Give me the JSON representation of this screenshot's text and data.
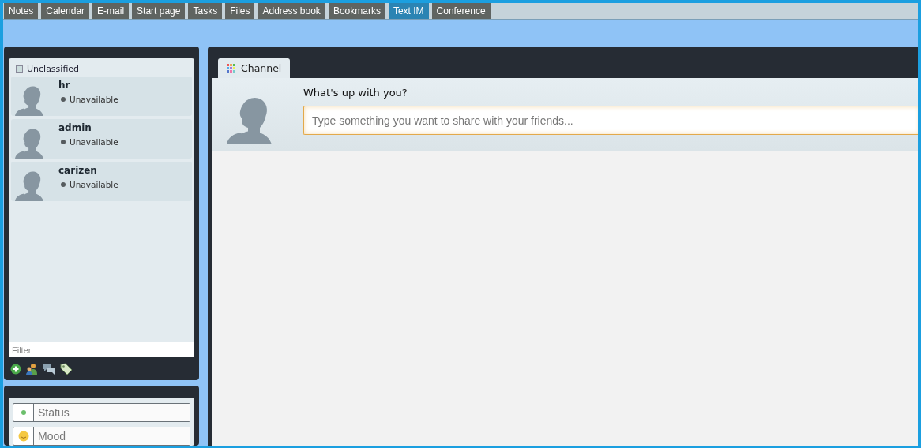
{
  "tabs": [
    {
      "label": "Notes",
      "selected": false
    },
    {
      "label": "Calendar",
      "selected": false
    },
    {
      "label": "E-mail",
      "selected": false
    },
    {
      "label": "Start page",
      "selected": false
    },
    {
      "label": "Tasks",
      "selected": false
    },
    {
      "label": "Files",
      "selected": false
    },
    {
      "label": "Address book",
      "selected": false
    },
    {
      "label": "Bookmarks",
      "selected": false
    },
    {
      "label": "Text IM",
      "selected": true
    },
    {
      "label": "Conference",
      "selected": false
    }
  ],
  "contacts": {
    "group": {
      "label": "Unclassified",
      "expanded": true
    },
    "items": [
      {
        "name": "hr",
        "status": "Unavailable",
        "color": "#555b5e"
      },
      {
        "name": "admin",
        "status": "Unavailable",
        "color": "#555b5e"
      },
      {
        "name": "carizen",
        "status": "Unavailable",
        "color": "#555b5e"
      }
    ],
    "filter": {
      "placeholder": "Filter"
    }
  },
  "presence": {
    "status": {
      "placeholder": "Status",
      "color": "#6cbf6c"
    },
    "mood": {
      "placeholder": "Mood"
    }
  },
  "channel": {
    "tab": {
      "label": "Channel",
      "selected": true
    },
    "prompt": "What's up with you?",
    "input": {
      "placeholder": "Type something you want to share with your friends..."
    }
  }
}
